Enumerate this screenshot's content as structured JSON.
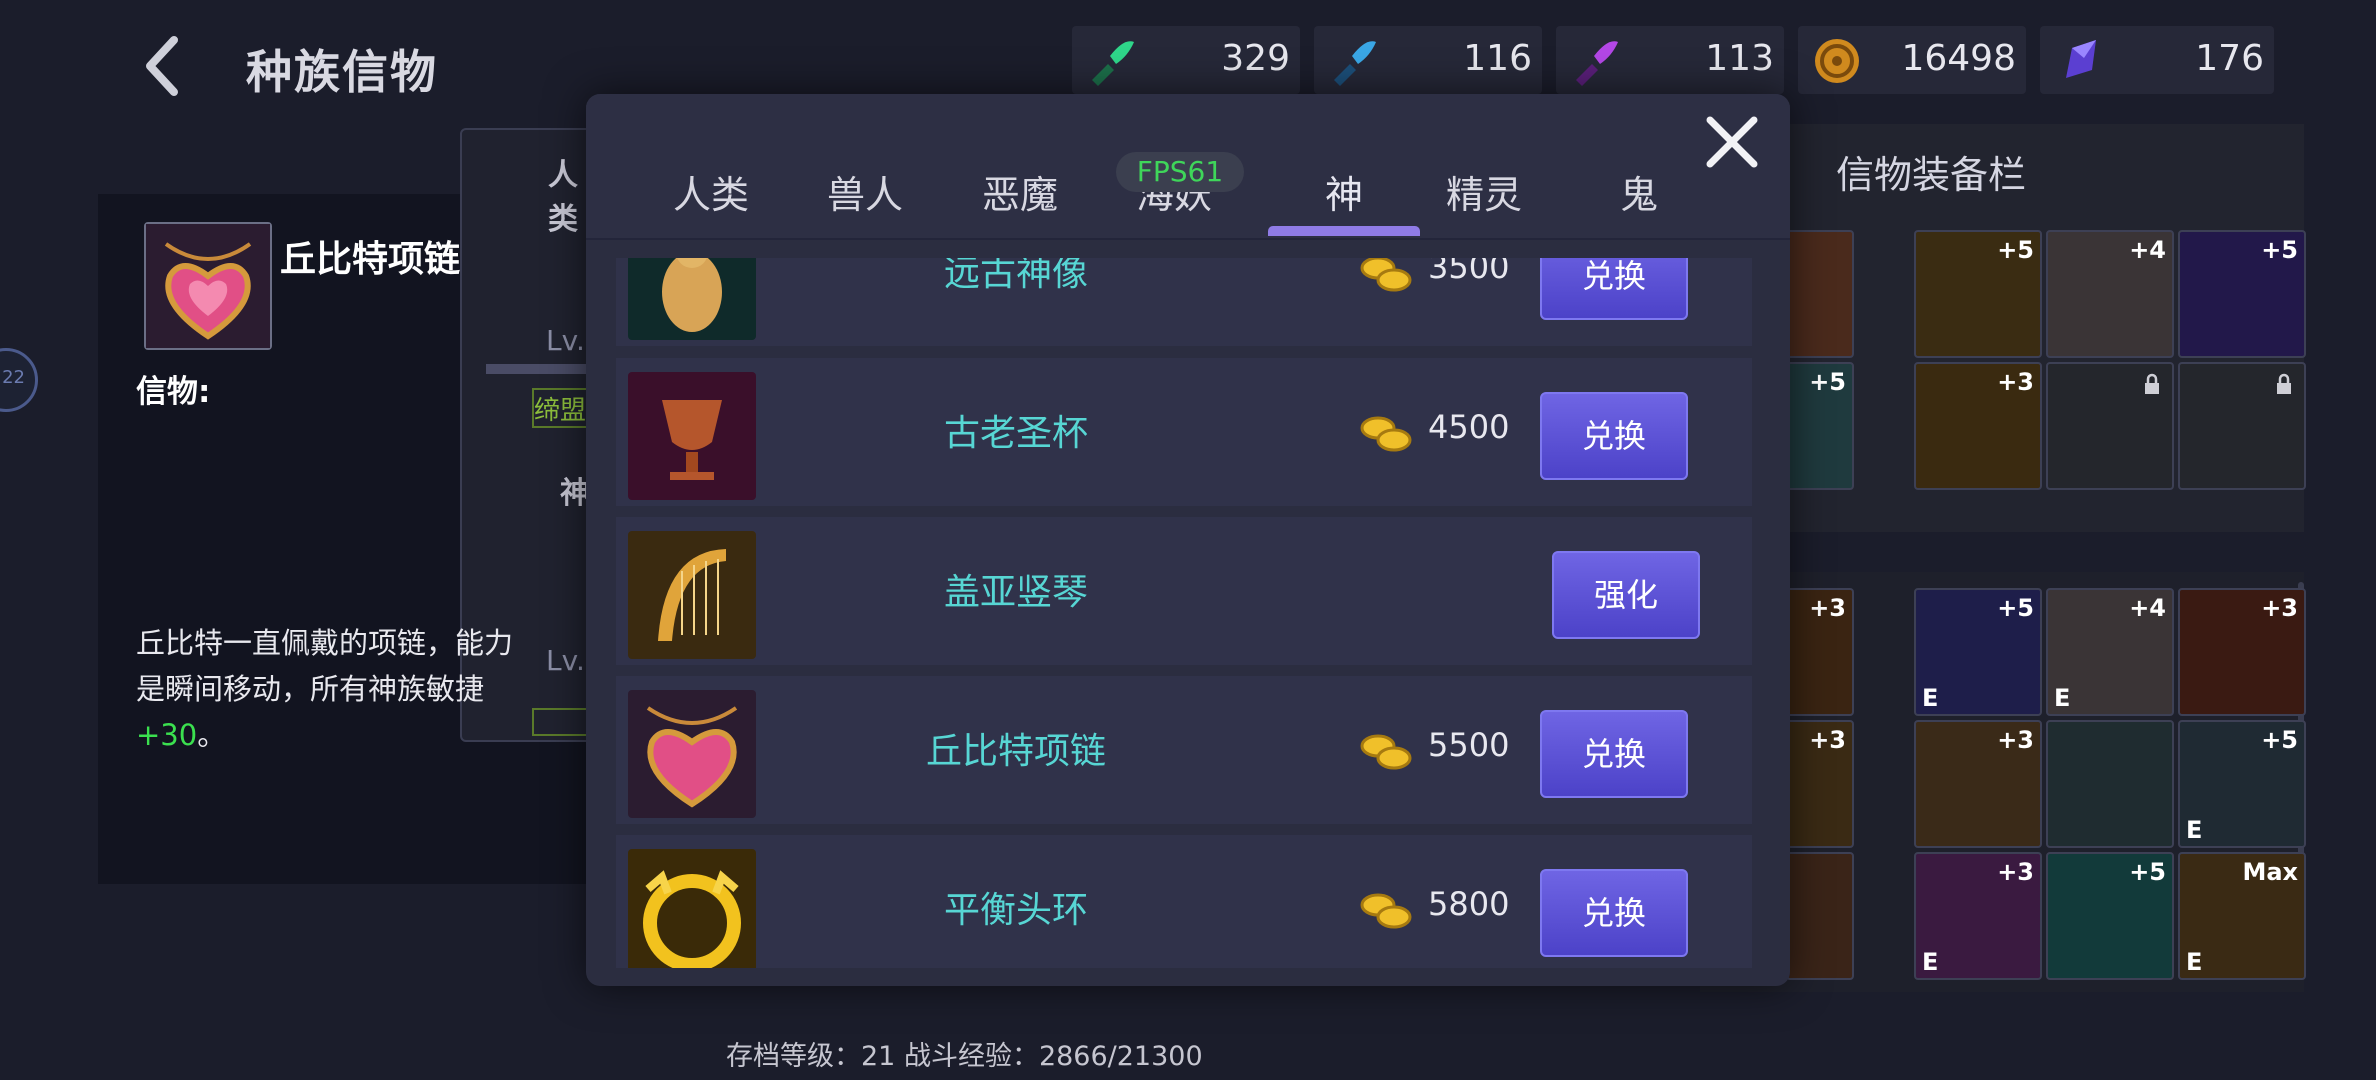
{
  "header": {
    "title": "种族信物"
  },
  "resources": [
    {
      "icon": "green-potion-icon",
      "value": "329"
    },
    {
      "icon": "blue-potion-icon",
      "value": "116"
    },
    {
      "icon": "purple-potion-icon",
      "value": "113"
    },
    {
      "icon": "gold-coin-icon",
      "value": "16498"
    },
    {
      "icon": "purple-crystal-icon",
      "value": "176"
    }
  ],
  "detail": {
    "name": "丘比特项链",
    "relic_label": "信物:",
    "desc_main": "丘比特一直佩戴的项链，能力是瞬间移动，所有神族敏捷",
    "desc_bonus": "+30",
    "desc_end": "。"
  },
  "background": {
    "col_top_label": "人类",
    "col_mid_label": "神",
    "col_lv": "Lv.",
    "col_tag": "缔盟",
    "equip_title": "信物装备栏",
    "edge_badge": "22"
  },
  "modal": {
    "tabs": [
      "人类",
      "兽人",
      "恶魔",
      "海妖",
      "神",
      "精灵",
      "鬼"
    ],
    "active_tab": "神",
    "fps_overlay": "FPS61",
    "items": [
      {
        "name": "远古神像",
        "price": "3500",
        "button": "兑换"
      },
      {
        "name": "古老圣杯",
        "price": "4500",
        "button": "兑换"
      },
      {
        "name": "盖亚竖琴",
        "price": "",
        "button": "强化"
      },
      {
        "name": "丘比特项链",
        "price": "5500",
        "button": "兑换"
      },
      {
        "name": "平衡头环",
        "price": "5800",
        "button": "兑换"
      }
    ]
  },
  "equip_slots_top": [
    {
      "badge": "",
      "e": ""
    },
    {
      "badge": "+5",
      "e": ""
    },
    {
      "badge": "+4",
      "e": ""
    },
    {
      "badge": "+5",
      "e": ""
    },
    {
      "badge": "+5",
      "e": ""
    },
    {
      "badge": "+3",
      "e": ""
    },
    {
      "badge": "",
      "e": ""
    },
    {
      "badge": "",
      "e": ""
    }
  ],
  "equip_slots_bottom": [
    {
      "badge": "+3",
      "e": ""
    },
    {
      "badge": "+5",
      "e": "E"
    },
    {
      "badge": "+4",
      "e": "E"
    },
    {
      "badge": "+3",
      "e": ""
    },
    {
      "badge": "+3",
      "e": ""
    },
    {
      "badge": "+3",
      "e": ""
    },
    {
      "badge": "",
      "e": ""
    },
    {
      "badge": "+5",
      "e": "E"
    },
    {
      "badge": "",
      "e": ""
    },
    {
      "badge": "+3",
      "e": "E"
    },
    {
      "badge": "+5",
      "e": ""
    },
    {
      "badge": "Max",
      "e": "E"
    }
  ],
  "footer": {
    "text": "存档等级：21 战斗经验：2866/21300"
  }
}
